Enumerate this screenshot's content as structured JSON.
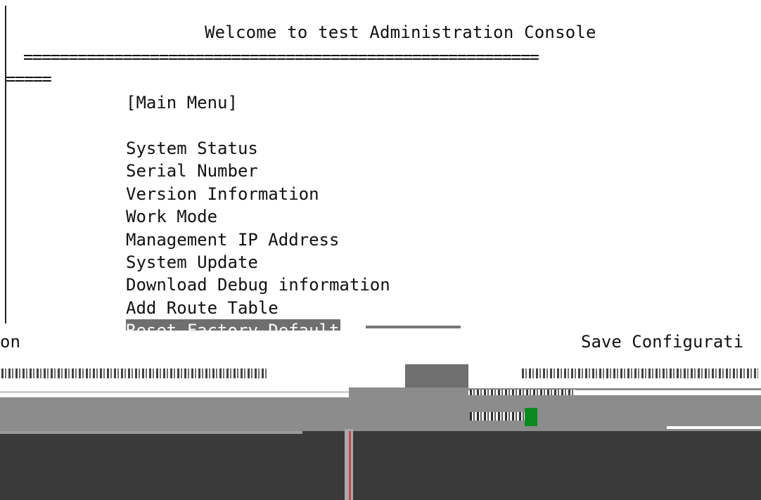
{
  "console": {
    "title": "Welcome to test Administration Console",
    "rule": "=========================================================",
    "rule_wrap": "=====",
    "menu_heading": "[Main Menu]",
    "menu_items": [
      "System Status",
      "Serial Number",
      "Version Information",
      "Work Mode",
      "Management IP Address",
      "System Update",
      "Download Debug information",
      "Add Route Table",
      "Reset Factory Default"
    ],
    "selected_index": 8
  },
  "glitch_region": {
    "left_fragment": "on",
    "right_fragment": "Save Configurati"
  },
  "colors": {
    "background": "#ffffff",
    "text": "#111111",
    "selection": "#6f6f6f",
    "dark_band": "#3a3a3a",
    "mid_band": "#8c8c8c",
    "green_accent": "#0a8a1e"
  }
}
